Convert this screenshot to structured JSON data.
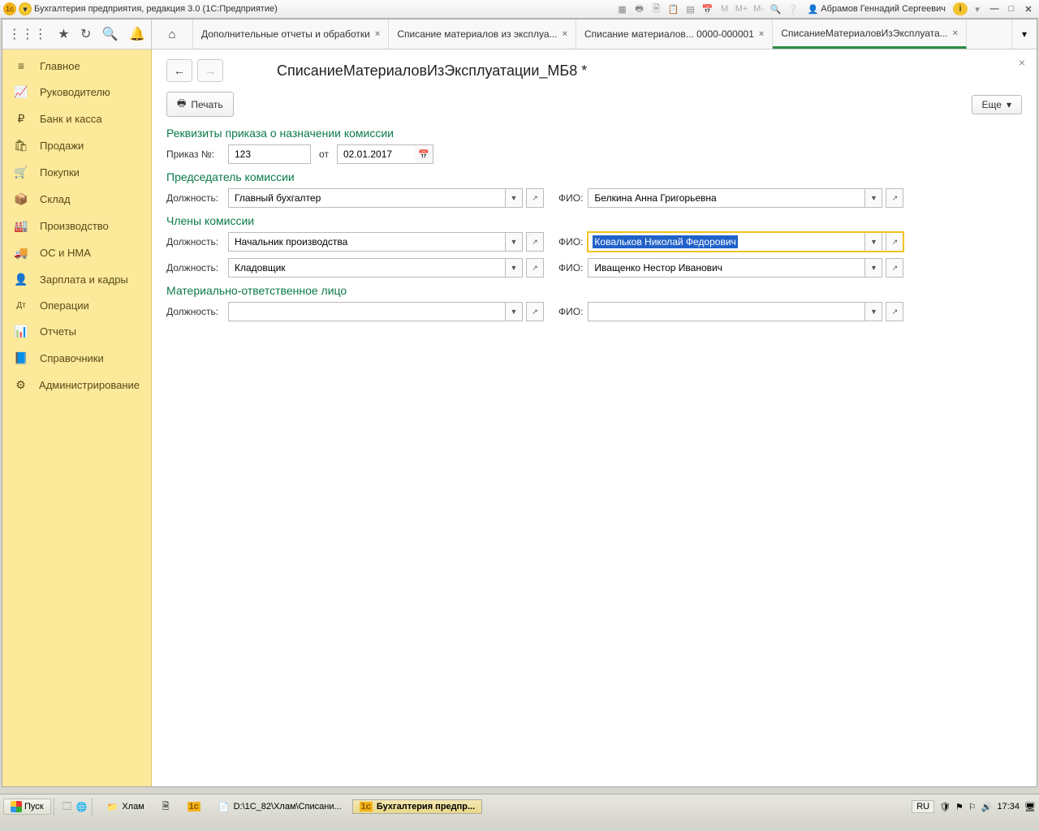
{
  "window_title": "Бухгалтерия предприятия, редакция 3.0  (1С:Предприятие)",
  "user_name": "Абрамов Геннадий Сергеевич",
  "toolbar_letters": [
    "M",
    "M+",
    "M-"
  ],
  "tabs": [
    {
      "label": "Дополнительные отчеты и обработки",
      "closeable": true
    },
    {
      "label": "Списание материалов из эксплуа...",
      "closeable": true
    },
    {
      "label": "Списание материалов... 0000-000001",
      "closeable": true
    },
    {
      "label": "СписаниеМатериаловИзЭксплуата...",
      "closeable": true,
      "active": true
    }
  ],
  "sidebar": [
    {
      "icon": "≡",
      "label": "Главное"
    },
    {
      "icon": "📈",
      "label": "Руководителю"
    },
    {
      "icon": "₽",
      "label": "Банк и касса"
    },
    {
      "icon": "🛍",
      "label": "Продажи"
    },
    {
      "icon": "🛒",
      "label": "Покупки"
    },
    {
      "icon": "📦",
      "label": "Склад"
    },
    {
      "icon": "🏭",
      "label": "Производство"
    },
    {
      "icon": "🚚",
      "label": "ОС и НМА"
    },
    {
      "icon": "👤",
      "label": "Зарплата и кадры"
    },
    {
      "icon": "Дт",
      "label": "Операции"
    },
    {
      "icon": "📊",
      "label": "Отчеты"
    },
    {
      "icon": "📘",
      "label": "Справочники"
    },
    {
      "icon": "⚙",
      "label": "Администрирование"
    }
  ],
  "page": {
    "title": "СписаниеМатериаловИзЭксплуатации_МБ8 *",
    "print_label": "Печать",
    "more_label": "Еще",
    "sections": {
      "order": {
        "header": "Реквизиты приказа о назначении комиссии",
        "num_label": "Приказ №:",
        "num_value": "123",
        "date_label": "от",
        "date_value": "02.01.2017"
      },
      "chairman": {
        "header": "Председатель комиссии",
        "pos_label": "Должность:",
        "pos_value": "Главный бухгалтер",
        "fio_label": "ФИО:",
        "fio_value": "Белкина Анна Григорьевна"
      },
      "members": {
        "header": "Члены комиссии",
        "rows": [
          {
            "pos_label": "Должность:",
            "pos_value": "Начальник производства",
            "fio_label": "ФИО:",
            "fio_value": "Ковальков Николай Федорович",
            "focused": true
          },
          {
            "pos_label": "Должность:",
            "pos_value": "Кладовщик",
            "fio_label": "ФИО:",
            "fio_value": "Иващенко Нестор Иванович"
          }
        ]
      },
      "mol": {
        "header": "Материально-ответственное лицо",
        "pos_label": "Должность:",
        "pos_value": "",
        "fio_label": "ФИО:",
        "fio_value": ""
      }
    }
  },
  "taskbar": {
    "start": "Пуск",
    "items": [
      {
        "icon": "📁",
        "label": "Хлам"
      },
      {
        "icon": "🗎",
        "label": ""
      },
      {
        "icon": "1c",
        "label": ""
      },
      {
        "icon": "📄",
        "label": "D:\\1C_82\\Хлам\\Списани..."
      },
      {
        "icon": "1c",
        "label": "Бухгалтерия предпр...",
        "active": true
      }
    ],
    "lang": "RU",
    "time": "17:34"
  }
}
